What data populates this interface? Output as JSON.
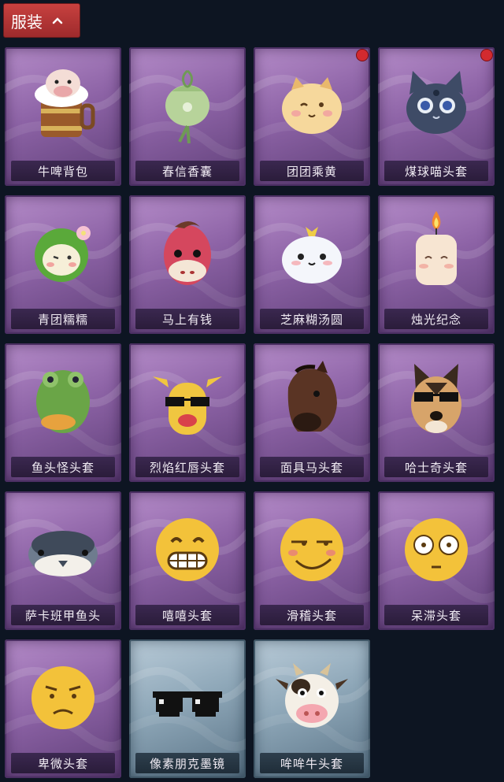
{
  "header": {
    "title": "服装"
  },
  "items": [
    {
      "label": "牛啤背包",
      "new": false,
      "style": "purple"
    },
    {
      "label": "春信香囊",
      "new": false,
      "style": "purple"
    },
    {
      "label": "团团乘黄",
      "new": true,
      "style": "purple"
    },
    {
      "label": "煤球喵头套",
      "new": true,
      "style": "purple"
    },
    {
      "label": "青团糯糯",
      "new": false,
      "style": "purple"
    },
    {
      "label": "马上有钱",
      "new": false,
      "style": "purple"
    },
    {
      "label": "芝麻糊汤圆",
      "new": false,
      "style": "purple"
    },
    {
      "label": "烛光纪念",
      "new": false,
      "style": "purple"
    },
    {
      "label": "鱼头怪头套",
      "new": false,
      "style": "purple"
    },
    {
      "label": "烈焰红唇头套",
      "new": false,
      "style": "purple"
    },
    {
      "label": "面具马头套",
      "new": false,
      "style": "purple"
    },
    {
      "label": "哈士奇头套",
      "new": false,
      "style": "purple"
    },
    {
      "label": "萨卡班甲鱼头",
      "new": false,
      "style": "purple"
    },
    {
      "label": "嘻嘻头套",
      "new": false,
      "style": "purple"
    },
    {
      "label": "滑稽头套",
      "new": false,
      "style": "purple"
    },
    {
      "label": "呆滞头套",
      "new": false,
      "style": "purple"
    },
    {
      "label": "卑微头套",
      "new": false,
      "style": "purple"
    },
    {
      "label": "像素朋克墨镜",
      "new": false,
      "style": "blue"
    },
    {
      "label": "哞哞牛头套",
      "new": false,
      "style": "blue"
    }
  ],
  "icons": [
    "beer-mug-cow-icon",
    "sachet-icon",
    "cat-bun-icon",
    "black-cat-mask-icon",
    "green-dumpling-icon",
    "red-horse-icon",
    "rice-ball-icon",
    "candle-icon",
    "fish-head-icon",
    "pikachu-mask-icon",
    "horse-mask-icon",
    "husky-mask-icon",
    "armored-fish-icon",
    "grin-emoji-icon",
    "smirk-emoji-icon",
    "stare-emoji-icon",
    "humble-emoji-icon",
    "pixel-sunglasses-icon",
    "cow-mask-icon"
  ]
}
